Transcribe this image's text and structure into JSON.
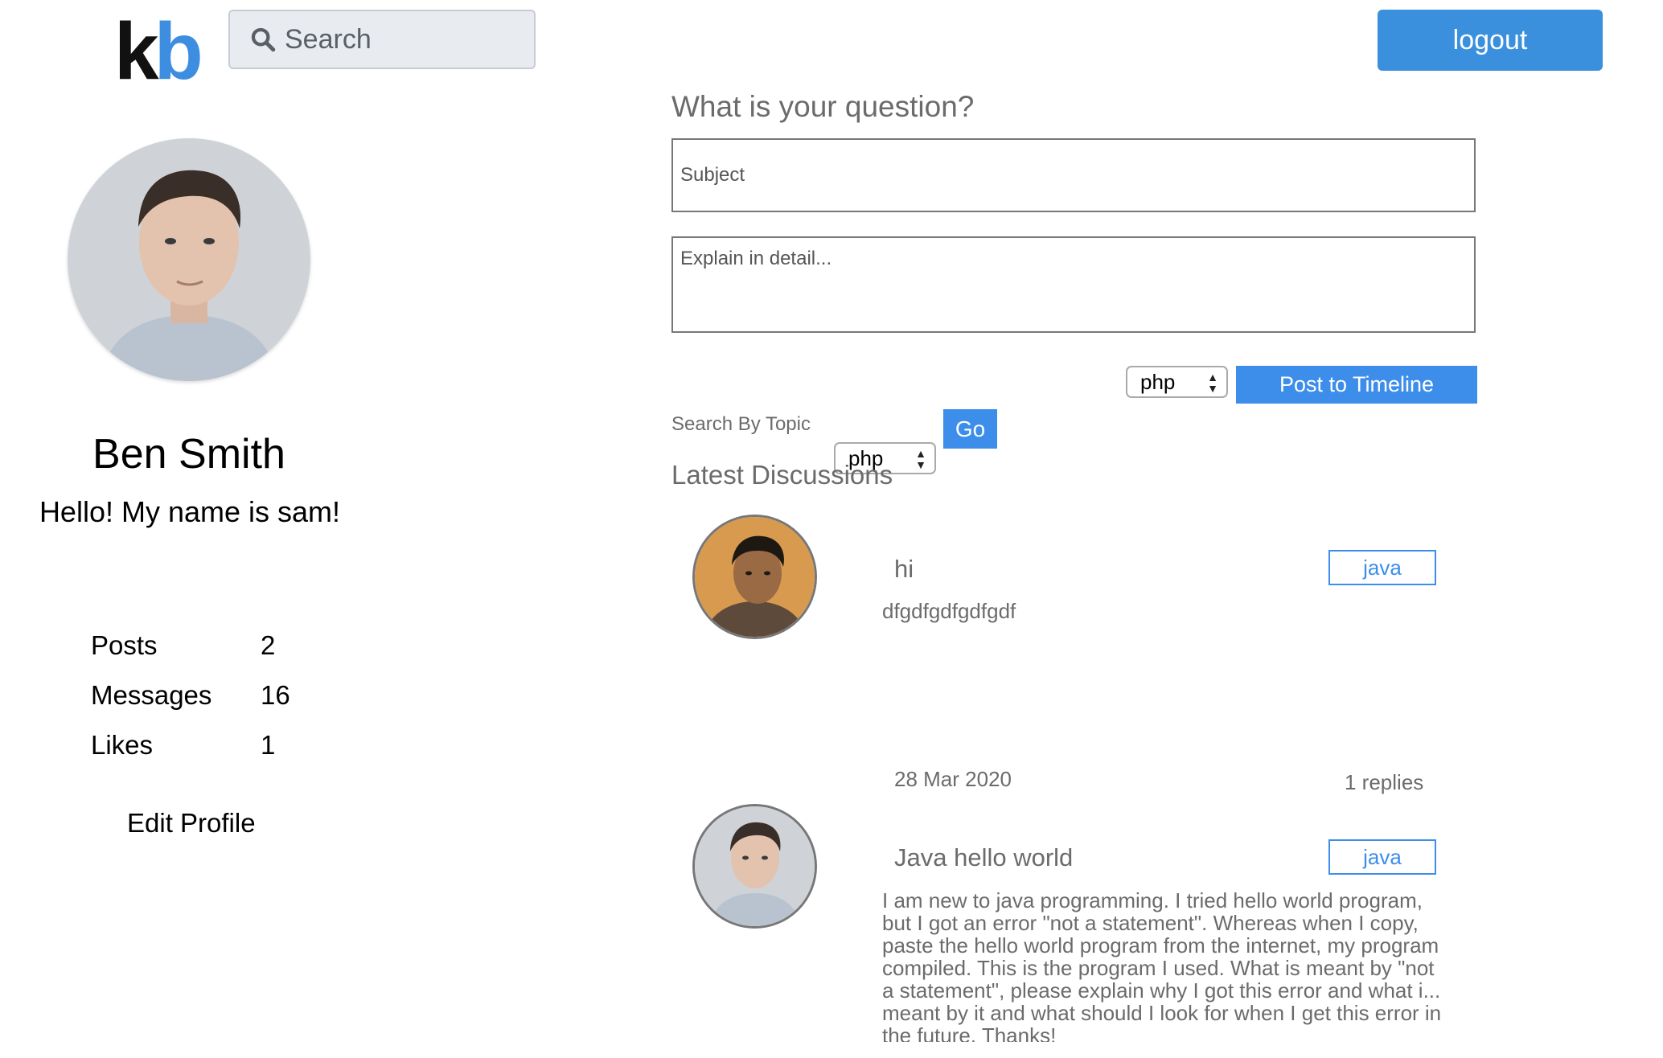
{
  "header": {
    "logo": {
      "k": "k",
      "b": "b"
    },
    "search": {
      "placeholder": "Search"
    },
    "logout_label": "logout"
  },
  "profile": {
    "name": "Ben Smith",
    "bio": "Hello! My name is sam!",
    "stats": [
      {
        "label": "Posts",
        "value": "2"
      },
      {
        "label": "Messages",
        "value": "16"
      },
      {
        "label": "Likes",
        "value": "1"
      }
    ],
    "edit_label": "Edit Profile"
  },
  "question_form": {
    "title": "What is your question?",
    "subject_placeholder": "Subject",
    "detail_placeholder": "Explain in detail...",
    "topic_selected": "php",
    "post_label": "Post to Timeline"
  },
  "topic_search": {
    "label": "Search By Topic",
    "selected": "php",
    "go_label": "Go"
  },
  "discussions": {
    "title": "Latest Discussions",
    "items": [
      {
        "title": "hi",
        "body": "dfgdfgdfgdfgdf",
        "tag": "java",
        "date": "28 Mar 2020",
        "replies": "1 replies"
      },
      {
        "title": "Java hello world",
        "body": "I am new to java programming. I tried hello world program, but I got an error \"not a statement\". Whereas when I copy, paste the hello world program from the internet, my program compiled. This is the program I used. What is meant by \"not a statement\", please explain why I got this error and what i... meant by it and what should I look for when I get this error in the future. Thanks!",
        "tag": "java"
      }
    ]
  },
  "colors": {
    "accent": "#3d8eeb",
    "logout": "#3a90dd",
    "muted_text": "#6b6b6b"
  }
}
